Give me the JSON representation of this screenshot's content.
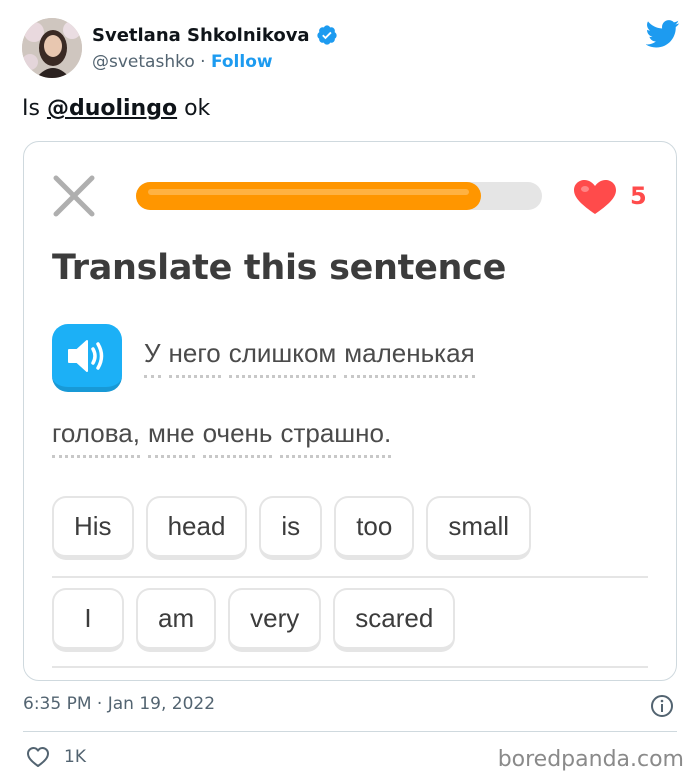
{
  "tweet": {
    "author_name": "Svetlana Shkolnikova",
    "handle": "@svetashko",
    "separator": " · ",
    "follow_label": "Follow",
    "text_prefix": "Is ",
    "mention": "@duolingo",
    "text_suffix": " ok",
    "timestamp": "6:35 PM · Jan 19, 2022",
    "like_count": "1K"
  },
  "lesson": {
    "progress_percent": 85,
    "hearts": "5",
    "title": "Translate this sentence",
    "sentence_line1": [
      "У",
      "него",
      "слишком",
      "маленькая"
    ],
    "sentence_line2": [
      "голова,",
      "мне",
      "очень",
      "страшно."
    ],
    "word_bank_row1": [
      "His",
      "head",
      "is",
      "too",
      "small"
    ],
    "word_bank_row2": [
      "I",
      "am",
      "very",
      "scared"
    ]
  },
  "watermark": "boredpanda.com",
  "colors": {
    "twitter_blue": "#1d9bf0",
    "progress_orange": "#ff9600",
    "heart_red": "#ff4b4b",
    "speaker_blue": "#1cb0f6"
  },
  "icons": [
    "verified-badge-icon",
    "twitter-bird-icon",
    "close-icon",
    "heart-icon",
    "speaker-icon",
    "info-icon",
    "like-heart-icon"
  ]
}
